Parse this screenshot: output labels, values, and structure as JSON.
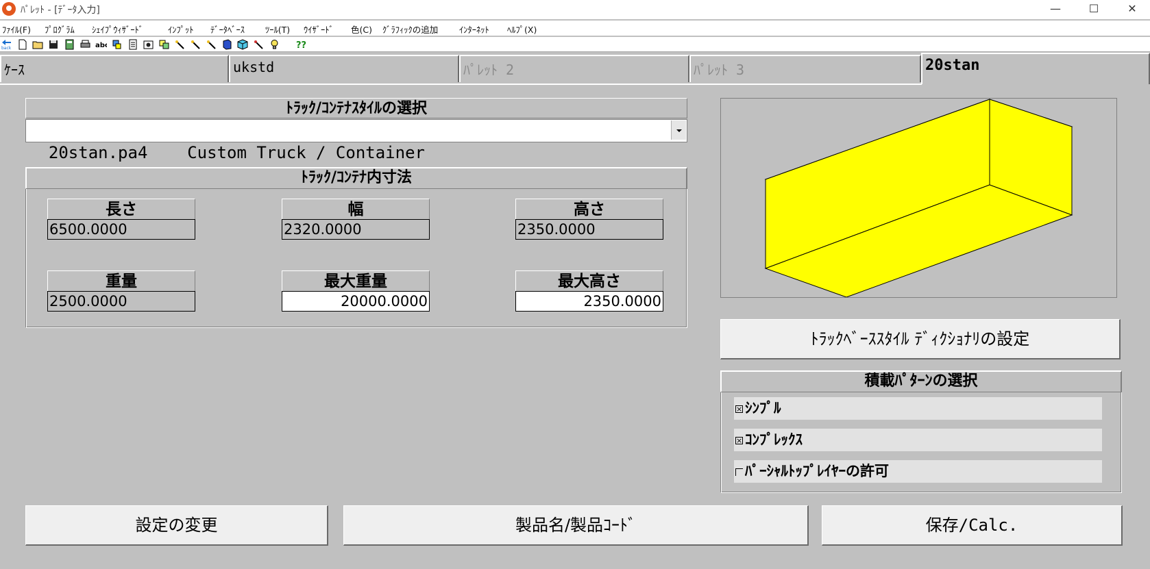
{
  "window": {
    "title": "ﾊﾟﾚｯﾄ - [ﾃﾞｰﾀ入力]",
    "minimize": "—",
    "maximize": "☐",
    "close": "✕"
  },
  "menu": [
    {
      "label": "ﾌｧｲﾙ(F)"
    },
    {
      "label": "ﾌﾟﾛｸﾞﾗﾑ"
    },
    {
      "label": "ｼｪｲﾌﾟｳｨｻﾞｰﾄﾞ"
    },
    {
      "label": "ｲﾝﾌﾟｯﾄ"
    },
    {
      "label": "ﾃﾞｰﾀﾍﾞｰｽ"
    },
    {
      "label": "ﾂｰﾙ(T)"
    },
    {
      "label": "ｳｲｻﾞｰﾄﾞ"
    },
    {
      "label": "色(C)"
    },
    {
      "label": "ｸﾞﾗﾌｨｯｸの追加"
    },
    {
      "label": "ｲﾝﾀｰﾈｯﾄ"
    },
    {
      "label": "ﾍﾙﾌﾟ(X)"
    }
  ],
  "toolbar": {
    "back_label": "back",
    "help_label": "??",
    "icons": [
      "back-icon",
      "new-file-icon",
      "open-folder-icon",
      "save-icon",
      "calculator-icon",
      "print-icon",
      "abc-icon",
      "paint-icon",
      "document-icon",
      "camera-icon",
      "copy-icon",
      "wand-icon",
      "wand-icon",
      "wand-icon",
      "book-icon",
      "box-icon",
      "wand-icon",
      "bulb-icon",
      "help-icon"
    ]
  },
  "tabs": [
    {
      "label": "ｹｰｽ",
      "state": "normal"
    },
    {
      "label": "ukstd",
      "state": "normal"
    },
    {
      "label": "ﾊﾟﾚｯﾄ 2",
      "state": "disabled"
    },
    {
      "label": "ﾊﾟﾚｯﾄ 3",
      "state": "disabled"
    },
    {
      "label": "20stan",
      "state": "active"
    }
  ],
  "style_select": {
    "header": "ﾄﾗｯｸ/ｺﾝﾃﾅｽﾀｲﾙの選択",
    "value": "20stan.pa4    Custom Truck / Container"
  },
  "dimensions": {
    "header": "ﾄﾗｯｸ/ｺﾝﾃﾅ内寸法",
    "fields": [
      {
        "label": "長さ",
        "value": "6500.0000",
        "editable": false
      },
      {
        "label": "幅",
        "value": "2320.0000",
        "editable": false
      },
      {
        "label": "高さ",
        "value": "2350.0000",
        "editable": false
      },
      {
        "label": "重量",
        "value": "2500.0000",
        "editable": false
      },
      {
        "label": "最大重量",
        "value": "20000.0000",
        "editable": true
      },
      {
        "label": "最大高さ",
        "value": "2350.0000",
        "editable": true
      }
    ]
  },
  "preview": {
    "fill_color": "#ffff00",
    "edge_color": "#000000"
  },
  "dictionary_button": "ﾄﾗｯｸﾍﾞｰｽｽﾀｲﾙ ﾃﾞｨｸｼｮﾅﾘの設定",
  "pattern": {
    "header": "積載ﾊﾟﾀｰﾝの選択",
    "options": [
      {
        "label": "ｼﾝﾌﾟﾙ",
        "checked": true
      },
      {
        "label": "ｺﾝﾌﾟﾚｯｸｽ",
        "checked": true
      },
      {
        "label": "ﾊﾟｰｼｬﾙﾄｯﾌﾟﾚｲﾔｰの許可",
        "checked": false
      }
    ],
    "checked_mark": "×"
  },
  "bottom_buttons": {
    "change_settings": "設定の変更",
    "product_name": "製品名/製品ｺｰﾄﾞ",
    "save_calc": "保存/Calc."
  },
  "colors": {
    "face": "#c0c0c0",
    "button_face": "#efefef",
    "box_yellow": "#ffff00",
    "app_icon": "#e2571e"
  }
}
